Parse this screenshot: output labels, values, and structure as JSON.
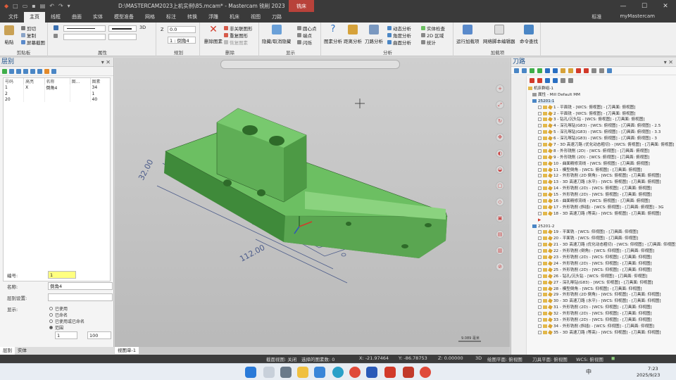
{
  "title_bar": {
    "title": "D:\\MASTERCAM2023上机实例\\85.mcam* - Mastercam 铣削 2023",
    "badge": "铣床"
  },
  "tabs": [
    "文件",
    "主页",
    "线框",
    "曲面",
    "实体",
    "模型准备",
    "网格",
    "标注",
    "转换",
    "浮雕",
    "机床",
    "视图",
    "刀路"
  ],
  "active_tab": "主页",
  "tab_right": {
    "mark": "标准",
    "account": "myMastercam"
  },
  "ribbon": {
    "clipboard": {
      "paste": "粘贴",
      "cut": "剪切",
      "copy": "复制",
      "screenshot": "屏幕截图",
      "group": "剪贴板"
    },
    "attributes": {
      "threed": "3D",
      "group": "属性"
    },
    "organize": {
      "z_label": "Z",
      "z_value": "0.0",
      "level_value": "1 : 倒角4",
      "group": "规划"
    },
    "delete": {
      "delete_entities": "删除图素",
      "undelete": "非关联图形",
      "recover": "重复图形",
      "restore": "恢复图素",
      "group": "删除"
    },
    "display": {
      "hide": "隐藏/取消隐藏",
      "center_point": "圆心点",
      "endpoint": "端点",
      "rotate": "闪烁",
      "group": "显示"
    },
    "analyze": {
      "entity": "图素分析",
      "distance": "距离分析",
      "toolpath": "刀路分析",
      "dynamic": "动态分析",
      "angle": "角度分析",
      "curve": "曲面分析",
      "solid_check": "实体检查",
      "area_2d": "2D 区域",
      "stats": "统计",
      "group": "分析"
    },
    "addins": {
      "run_addin": "运行加载项",
      "net_script": "网络脚本编辑器",
      "command": "命令查找",
      "group": "加载项"
    }
  },
  "left_panel": {
    "title": "层别",
    "columns": [
      "号码",
      "高亮",
      "名称",
      "图...",
      "图素"
    ],
    "rows": [
      {
        "num": "1",
        "vis": "X",
        "name": "倒角4",
        "set": "",
        "count": "34"
      },
      {
        "num": "2",
        "vis": "",
        "name": "",
        "set": "",
        "count": "1"
      },
      {
        "num": "20",
        "vis": "",
        "name": "",
        "set": "",
        "count": "40"
      }
    ],
    "props": {
      "number_label": "编号:",
      "number_value": "1",
      "name_label": "名称:",
      "name_value": "倒角4",
      "levelset_label": "层别设置:",
      "levelset_value": "",
      "display_label": "显示:",
      "options": [
        "已使用",
        "已命名",
        "已使用或已命名",
        "范围"
      ],
      "range_from": "1",
      "range_to": "100"
    },
    "bottom_tabs": [
      "层别",
      "实体"
    ]
  },
  "viewport": {
    "sheet_tab": "视图单-1",
    "dim_left": "32.00",
    "dim_bottom": "112.00",
    "scale_label": "9.089 毫米"
  },
  "right_panel": {
    "title": "刀路",
    "machine_group": "机床群组-1",
    "properties": "属性 - Mill Default MM",
    "groups": [
      {
        "name": "25201-1",
        "ops": [
          "1 - 平面铣 - [WCS: 俯视图] - [刀具面: 俯视图]",
          "2 - 平面铣 - [WCS: 俯视图] - [刀具面: 俯视图]",
          "3 - 钻孔/沉头钻 - [WCS: 俯视图] - [刀具面: 俯视图]",
          "4 - 深孔啄钻(G83) - [WCS: 俯视图] - [刀具面: 俯视图] - 2.5",
          "5 - 深孔啄钻(G83) - [WCS: 俯视图] - [刀具面: 俯视图] - 3.3",
          "6 - 深孔啄钻(G83) - [WCS: 俯视图] - [刀具面: 俯视图] - 3",
          "7 - 3D 高速刀路 (优化动态粗切) - [WCS: 俯视图] - [刀具面: 俯视图]",
          "8 - 外形铣削 (2D) - [WCS: 俯视图] - [刀具面: 俯视图]",
          "9 - 外形铣削 (2D) - [WCS: 俯视图] - [刀具面: 俯视图]",
          "10 - 曲面精修流线 - [WCS: 俯视图] - [刀具面: 俯视图]",
          "11 - 模型倒角 - [WCS: 俯视图] - [刀具面: 俯视图]",
          "12 - 外形铣削 (2D 倒角) - [WCS: 俯视图] - [刀具面: 俯视图]",
          "13 - 3D 高速刀路 (水平) - [WCS: 俯视图] - [刀具面: 俯视图]",
          "14 - 外形铣削 (2D) - [WCS: 俯视图] - [刀具面: 俯视图]",
          "15 - 外形铣削 (2D) - [WCS: 俯视图] - [刀具面: 俯视图]",
          "16 - 曲面精修流线 - [WCS: 俯视图] - [刀具面: 俯视图]",
          "17 - 外形铣削 (斜插) - [WCS: 俯视图] - [刀具面: 俯视图] - 3G",
          "18 - 3D 高速刀路 (等高) - [WCS: 俯视图] - [刀具面: 俯视图]"
        ]
      },
      {
        "name": "25201-2",
        "ops": [
          "19 - 平面铣 - [WCS: 仰视图] - [刀具面: 仰视图]",
          "20 - 平面铣 - [WCS: 仰视图] - [刀具面: 仰视图]",
          "21 - 3D 高速刀路 (优化动态粗切) - [WCS: 仰视图] - [刀具面: 仰视图]",
          "22 - 外形铣削 (倒角) - [WCS: 仰视图] - [刀具面: 仰视图]",
          "23 - 外形铣削 (2D) - [WCS: 仰视图] - [刀具面: 仰视图]",
          "24 - 外形铣削 (2D) - [WCS: 仰视图] - [刀具面: 仰视图]",
          "25 - 外形铣削 (2D) - [WCS: 仰视图] - [刀具面: 仰视图]",
          "26 - 钻孔/沉头钻 - [WCS: 仰视图] - [刀具面: 仰视图]",
          "27 - 深孔啄钻(G83) - [WCS: 仰视图] - [刀具面: 仰视图]",
          "28 - 模型倒角 - [WCS: 仰视图] - [刀具面: 仰视图]",
          "29 - 外形铣削 (2D 倒角) - [WCS: 仰视图] - [刀具面: 仰视图]",
          "30 - 3D 高速刀路 (水平) - [WCS: 仰视图] - [刀具面: 仰视图]",
          "31 - 外形铣削 (2D) - [WCS: 仰视图] - [刀具面: 仰视图]",
          "32 - 外形铣削 (2D) - [WCS: 仰视图] - [刀具面: 仰视图]",
          "33 - 外形铣削 (2D) - [WCS: 仰视图] - [刀具面: 仰视图]",
          "34 - 外形铣削 (斜插) - [WCS: 仰视图] - [刀具面: 仰视图]",
          "35 - 3D 高速刀路 (等高) - [WCS: 仰视图] - [刀具面: 仰视图]"
        ]
      }
    ]
  },
  "status_bar": {
    "section": "截面视图: 关闭",
    "selected": "选择的图素数: 0",
    "x": "X: -21.97464",
    "y": "Y: -86.78753",
    "z": "Z: 0.00000",
    "mode": "3D",
    "gview": "绘图平面: 俯视图",
    "tplane": "刀具平面: 俯视图",
    "wcs": "WCS: 俯视图"
  },
  "taskbar": {
    "ime": "中",
    "time": "7:23",
    "date": "2025/9/23"
  },
  "colors": {
    "part": "#6cbf62",
    "part_dark": "#3f8a3a",
    "accent": "#b8423a",
    "dim": "#4b5b8a"
  }
}
